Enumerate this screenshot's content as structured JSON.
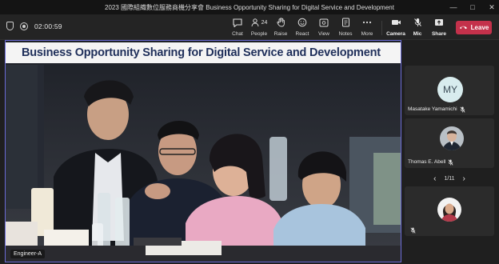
{
  "window": {
    "title": "2023 國際組織數位服務商機分享會 Business Opportunity Sharing for Digital Service and Development",
    "controls": [
      "—",
      "□",
      "✕"
    ]
  },
  "toolbar": {
    "timer": "02:00:59",
    "buttons": [
      {
        "id": "chat",
        "label": "Chat",
        "icon": "chat-icon"
      },
      {
        "id": "people",
        "label": "People",
        "icon": "people-icon",
        "count": "24"
      },
      {
        "id": "raise",
        "label": "Raise",
        "icon": "hand-icon"
      },
      {
        "id": "react",
        "label": "React",
        "icon": "smiley-icon"
      },
      {
        "id": "view",
        "label": "View",
        "icon": "view-icon"
      },
      {
        "id": "notes",
        "label": "Notes",
        "icon": "notes-icon"
      },
      {
        "id": "more",
        "label": "More",
        "icon": "ellipsis-icon"
      },
      {
        "id": "camera",
        "label": "Camera",
        "icon": "camera-icon"
      },
      {
        "id": "mic",
        "label": "Mic",
        "icon": "mic-icon"
      },
      {
        "id": "share",
        "label": "Share",
        "icon": "share-icon"
      }
    ],
    "leave_label": "Leave"
  },
  "stage": {
    "banner": "Business Opportunity Sharing for Digital Service and  Development",
    "participant_tag": "Engineer-A"
  },
  "participants": {
    "tiles": [
      {
        "initials": "MY",
        "name": "Masatake Yamamichi"
      },
      {
        "name": "Thomas E. Abell"
      },
      {
        "name": ""
      }
    ],
    "pager": {
      "label": "1/11",
      "prev": "‹",
      "next": "›"
    }
  },
  "colors": {
    "leave": "#c4314b",
    "stage_border": "#6b6bd6",
    "banner_text": "#1f2f5a"
  }
}
